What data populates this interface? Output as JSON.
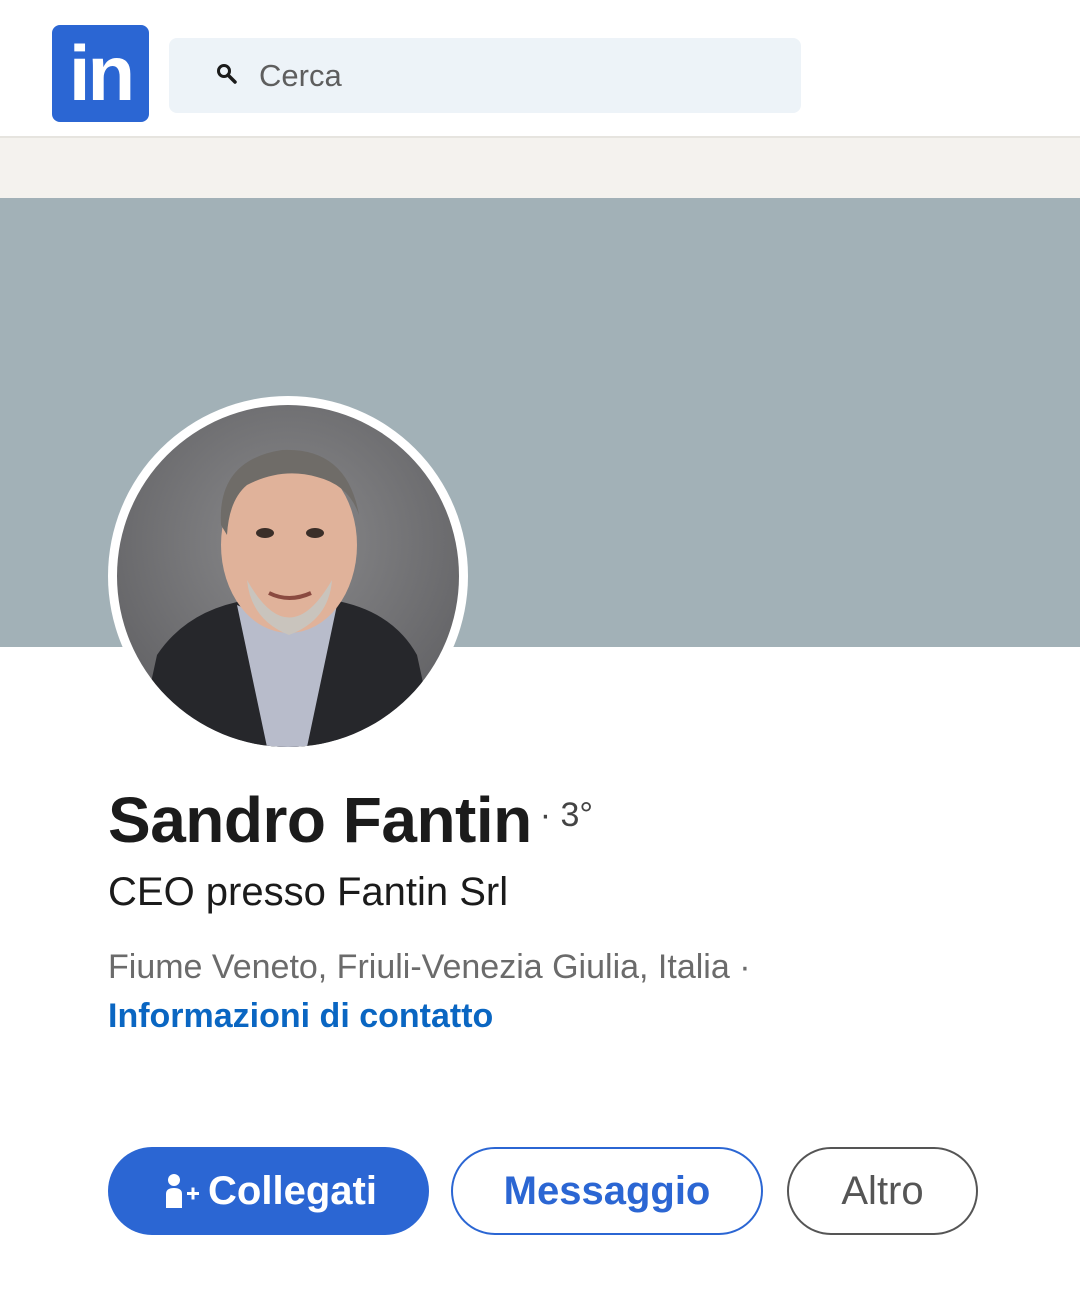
{
  "header": {
    "logo_text": "in",
    "search_placeholder": "Cerca",
    "search_icon": "search-icon"
  },
  "profile": {
    "name": "Sandro Fantin",
    "degree": "· 3°",
    "headline": "CEO presso Fantin Srl",
    "location": "Fiume Veneto, Friuli-Venezia Giulia, Italia ·",
    "contact_info_link": "Informazioni di contatto"
  },
  "actions": {
    "connect_label": "Collegati",
    "connect_icon": "add-person-icon",
    "message_label": "Messaggio",
    "more_label": "Altro"
  },
  "colors": {
    "brand_blue": "#2b66d3",
    "link_blue": "#0a66c2",
    "cover": "#a2b1b7",
    "search_bg": "#edf3f8"
  }
}
